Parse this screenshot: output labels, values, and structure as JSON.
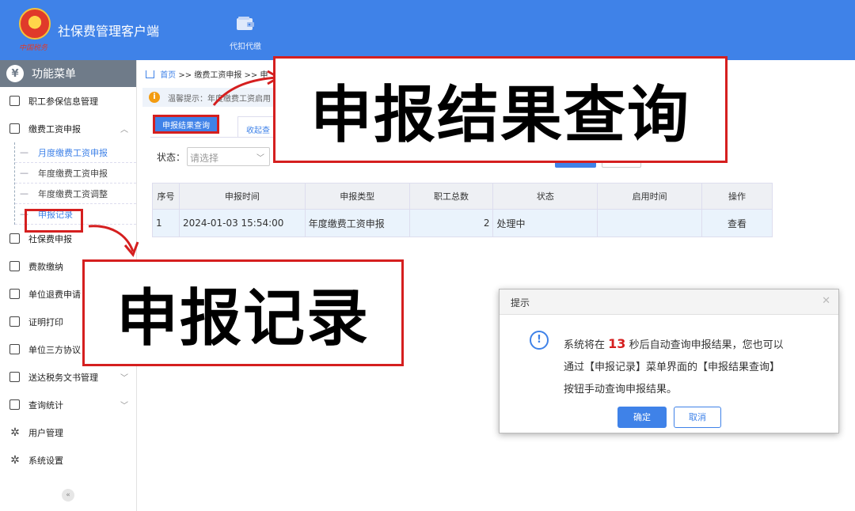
{
  "header": {
    "app_title": "社保费管理客户端",
    "logo_sub": "中国税务",
    "toolbar_item_label": "代扣代缴"
  },
  "sidebar": {
    "title": "功能菜单",
    "items": [
      {
        "label": "职工参保信息管理"
      },
      {
        "label": "缴费工资申报"
      },
      {
        "label": "社保费申报"
      },
      {
        "label": "费款缴纳"
      },
      {
        "label": "单位退费申请"
      },
      {
        "label": "证明打印"
      },
      {
        "label": "单位三方协议"
      },
      {
        "label": "送达税务文书管理"
      },
      {
        "label": "查询统计"
      },
      {
        "label": "用户管理"
      },
      {
        "label": "系统设置"
      }
    ],
    "submenu": [
      {
        "label": "月度缴费工资申报"
      },
      {
        "label": "年度缴费工资申报"
      },
      {
        "label": "年度缴费工资调整"
      },
      {
        "label": "申报记录"
      }
    ]
  },
  "breadcrumb": {
    "home": "首页",
    "sep": ">>",
    "level1": "缴费工资申报",
    "level2": "申"
  },
  "notice": "温馨提示：年度缴费工资启用",
  "tabs": {
    "result_query": "申报结果查询",
    "collapse": "收起查"
  },
  "filter": {
    "status_label": "状态：",
    "status_placeholder": "请选择"
  },
  "table": {
    "columns": [
      "序号",
      "申报时间",
      "申报类型",
      "职工总数",
      "状态",
      "启用时间",
      "操作"
    ],
    "rows": [
      {
        "no": "1",
        "time": "2024-01-03 15:54:00",
        "type": "年度缴费工资申报",
        "count": "2",
        "status": "处理中",
        "enable_time": "",
        "action": "查看"
      }
    ]
  },
  "dialog": {
    "title": "提示",
    "text_before": "系统将在",
    "countdown": "13",
    "text_after": "秒后自动查询申报结果，您也可以",
    "line2": "通过【申报记录】菜单界面的【申报结果查询】",
    "line3": "按钮手动查询申报结果。",
    "ok": "确定",
    "cancel": "取消"
  },
  "annotations": {
    "callout_result": "申报结果查询",
    "callout_record": "申报记录",
    "accent_color": "#d51f1f",
    "brand_color": "#3f82e8"
  }
}
